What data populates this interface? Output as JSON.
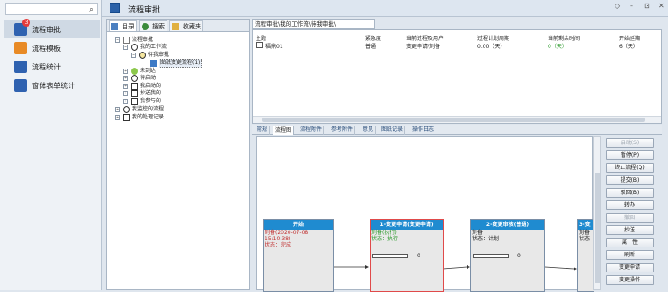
{
  "app": {
    "title": "流程审批"
  },
  "search": {
    "placeholder": ""
  },
  "sidebar": {
    "items": [
      {
        "label": "流程审批",
        "badge": "3",
        "color": "#2f62b0"
      },
      {
        "label": "流程模板",
        "color": "#e88a25"
      },
      {
        "label": "流程统计",
        "color": "#2f62b0"
      },
      {
        "label": "窗体表单统计",
        "color": "#2f62b0"
      }
    ]
  },
  "tree": {
    "tabs": [
      "目录",
      "搜索",
      "收藏夹"
    ],
    "nodes": [
      "流程审批",
      "我的工作流",
      "待我审批",
      "图纸变更流程(1)",
      "未到达",
      "待启动",
      "我启动的",
      "抄送我的",
      "我参与的",
      "我监控的流程",
      "我的处理记录"
    ]
  },
  "breadcrumb": "流程审批\\我的工作流\\待我审批\\",
  "grid": {
    "columns": [
      "主题",
      "紧急度",
      "当前过程及用户",
      "过程计划周期",
      "当前剩余时间",
      "开始延期"
    ],
    "rows": [
      [
        "福鼎01",
        "普通",
        "变更申请/刘备",
        "0.00（天）",
        "0（天）",
        "6（天）"
      ]
    ]
  },
  "detail_tabs": [
    "常规",
    "流程图",
    "流程附件",
    "参考附件",
    "意见",
    "图纸记录",
    "操作日志"
  ],
  "flow": {
    "nodes": [
      {
        "title": "开始",
        "lines": [
          "刘备(2020-07-08",
          "15:10:38)",
          "状态：完成"
        ]
      },
      {
        "title": "1-变更申请(变更申请)",
        "lines": [
          "刘备(执行)",
          "状态：执行"
        ],
        "progress": "0"
      },
      {
        "title": "2-变更审核(普通)",
        "lines": [
          "刘备",
          "状态：计划"
        ],
        "progress": "0"
      },
      {
        "title": "3-变",
        "lines": [
          "刘备",
          "状态"
        ]
      }
    ]
  },
  "actions": [
    "启动(S)",
    "暂停(P)",
    "终止流程(Q)",
    "提交(B)",
    "驳回(B)",
    "转办",
    "撤回",
    "抄送",
    "属　性",
    "刷新",
    "变更申请",
    "变更操作"
  ],
  "window": {
    "controls": [
      "◇",
      "–",
      "⊡",
      "✕"
    ]
  }
}
